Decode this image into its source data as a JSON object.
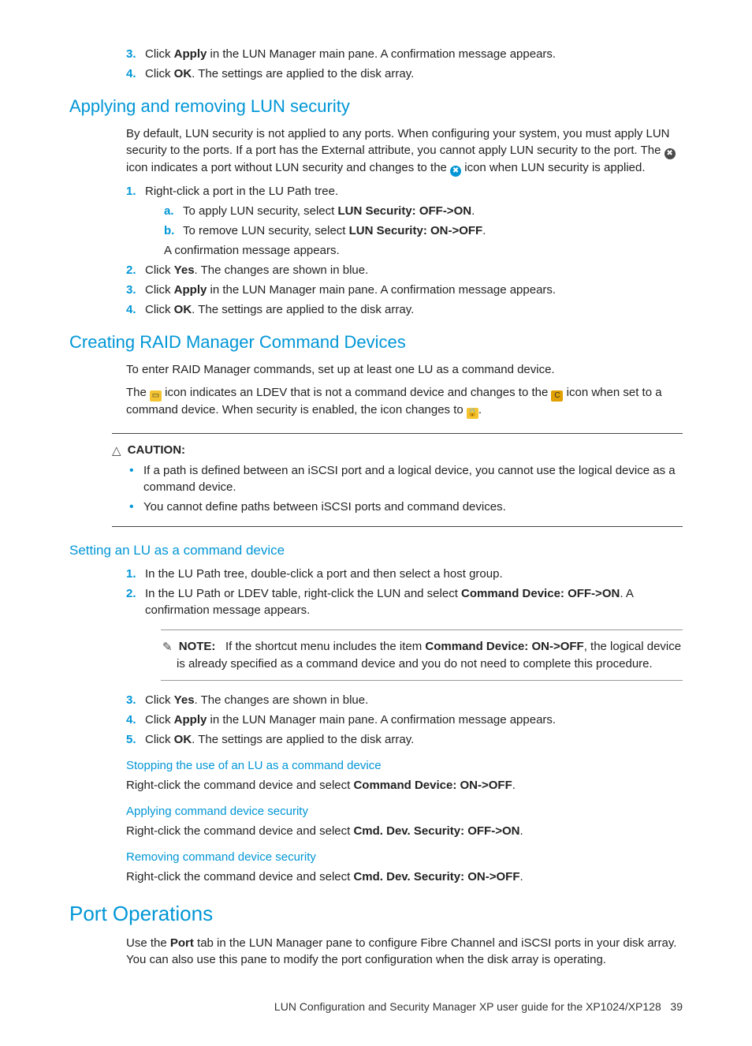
{
  "top_list": {
    "item3_pre": "Click ",
    "item3_bold": "Apply",
    "item3_post": " in the LUN Manager main pane. A confirmation message appears.",
    "item4_pre": "Click ",
    "item4_bold": "OK",
    "item4_post": ". The settings are applied to the disk array."
  },
  "sec1": {
    "title": "Applying and removing LUN security",
    "intro_a": "By default, LUN security is not applied to any ports. When configuring your system, you must apply LUN security to the ports. If a port has the External attribute, you cannot apply LUN security to the port. The ",
    "intro_b": " icon indicates a port without LUN security and changes to the ",
    "intro_c": " icon when LUN security is applied.",
    "step1": "Right-click a port in the LU Path tree.",
    "step1a_pre": "To apply LUN security, select ",
    "step1a_bold": "LUN Security: OFF->ON",
    "step1b_pre": "To remove LUN security, select ",
    "step1b_bold": "LUN Security: ON->OFF",
    "step1_tail": "A confirmation message appears.",
    "step2_pre": "Click ",
    "step2_bold": "Yes",
    "step2_post": ". The changes are shown in blue.",
    "step3_pre": "Click ",
    "step3_bold": "Apply",
    "step3_post": " in the LUN Manager main pane. A confirmation message appears.",
    "step4_pre": "Click ",
    "step4_bold": "OK",
    "step4_post": ". The settings are applied to the disk array."
  },
  "sec2": {
    "title": "Creating RAID Manager Command Devices",
    "intro1": "To enter RAID Manager commands, set up at least one LU as a command device.",
    "intro2a": "The ",
    "intro2b": " icon indicates an LDEV that is not a command device and changes to the ",
    "intro2c": " icon when set to a command device. When security is enabled, the icon changes to ",
    "caution_label": "CAUTION:",
    "caution1": "If a path is defined between an iSCSI port and a logical device, you cannot use the logical device as a command device.",
    "caution2": "You cannot define paths between iSCSI ports and command devices."
  },
  "sec3": {
    "title": "Setting an LU as a command device",
    "step1": "In the LU Path tree, double-click a port and then select a host group.",
    "step2_pre": "In the LU Path or LDEV table, right-click the LUN and select ",
    "step2_bold": "Command Device: OFF->ON",
    "step2_post": ". A confirmation message appears.",
    "note_label": "NOTE:",
    "note_pre": "If the shortcut menu includes the item ",
    "note_bold": "Command Device: ON->OFF",
    "note_post": ", the logical device is already specified as a command device and you do not need to complete this procedure.",
    "step3_pre": "Click ",
    "step3_bold": "Yes",
    "step3_post": ". The changes are shown in blue.",
    "step4_pre": "Click ",
    "step4_bold": "Apply",
    "step4_post": " in the LUN Manager main pane. A confirmation message appears.",
    "step5_pre": "Click ",
    "step5_bold": "OK",
    "step5_post": ". The settings are applied to the disk array.",
    "sub1_title": "Stopping the use of an LU as a command device",
    "sub1_pre": "Right-click the command device and select ",
    "sub1_bold": "Command Device: ON->OFF",
    "sub2_title": "Applying command device security",
    "sub2_pre": "Right-click the command device and select ",
    "sub2_bold": "Cmd. Dev. Security: OFF->ON",
    "sub3_title": "Removing command device security",
    "sub3_pre": "Right-click the command device and select ",
    "sub3_bold": "Cmd. Dev. Security: ON->OFF"
  },
  "sec4": {
    "title": "Port Operations",
    "body_pre": "Use the ",
    "body_bold": "Port",
    "body_post": " tab in the LUN Manager pane to configure Fibre Channel and iSCSI ports in your disk array. You can also use this pane to modify the port configuration when the disk array is operating."
  },
  "footer": {
    "text": "LUN Configuration and Security Manager XP user guide for the XP1024/XP128",
    "page": "39"
  }
}
